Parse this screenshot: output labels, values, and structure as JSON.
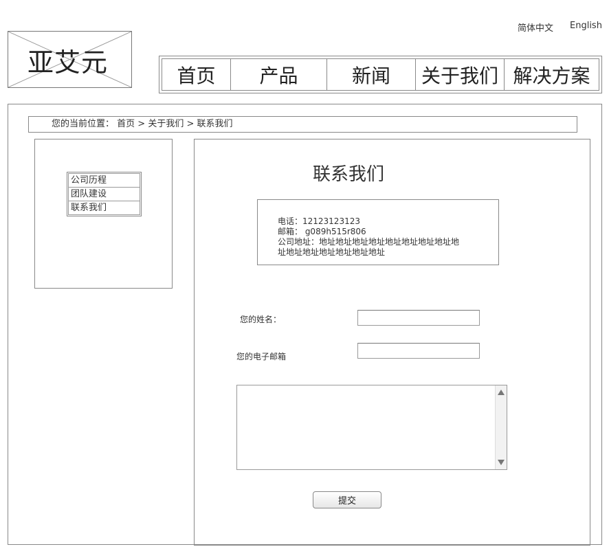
{
  "header": {
    "lang_zh": "简体中文",
    "lang_en": "English",
    "logo_text": "亚艾元"
  },
  "nav": {
    "items": [
      {
        "label": "首页"
      },
      {
        "label": "产品"
      },
      {
        "label": "新闻"
      },
      {
        "label": "关于我们"
      },
      {
        "label": "解决方案"
      }
    ]
  },
  "breadcrumb": {
    "prefix": "您的当前位置：",
    "path": "首页 > 关于我们 > 联系我们"
  },
  "sidebar": {
    "items": [
      {
        "label": "公司历程"
      },
      {
        "label": "团队建设"
      },
      {
        "label": "联系我们"
      }
    ]
  },
  "content": {
    "title": "联系我们",
    "info": {
      "phone": "电话：12123123123",
      "email": "邮箱： g089h515r806",
      "address_line1": "公司地址：地址地址地址地址地址地址地址地址地",
      "address_line2": "址地址地址地址地址地址地址"
    },
    "form": {
      "name_label": "您的姓名：",
      "name_value": "",
      "email_label": "您的电子邮箱",
      "email_value": "",
      "message_value": "",
      "submit_label": "提交"
    }
  }
}
